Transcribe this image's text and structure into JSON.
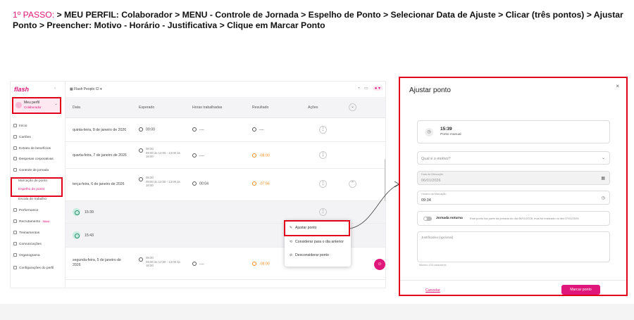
{
  "instruction": {
    "step": "1º PASSO:",
    "text": " > MEU PERFIL: Colaborador > MENU - Controle de Jornada > Espelho de Ponto > Selecionar Data de Ajuste > Clicar (três pontos) > Ajustar Ponto > Preencher: Motivo - Horário - Justificativa > Clique em Marcar Ponto"
  },
  "sidebar": {
    "logo": "flash",
    "profile": {
      "title": "Meu perfil",
      "role": "Colaborador"
    },
    "items": [
      {
        "label": "Início",
        "icon": "home-icon"
      },
      {
        "label": "Cartões",
        "icon": "card-icon"
      },
      {
        "label": "Extrato de benefícios",
        "icon": "list-icon"
      },
      {
        "label": "Despesas corporativas",
        "icon": "wallet-icon"
      },
      {
        "label": "Controle de jornada",
        "icon": "clock-icon"
      }
    ],
    "sub_items": [
      {
        "label": "Marcação de ponto"
      },
      {
        "label": "Espelho de ponto"
      },
      {
        "label": "Escala de trabalho"
      }
    ],
    "more_items": [
      {
        "label": "Performance",
        "icon": "chart-icon"
      },
      {
        "label": "Recrutamento",
        "icon": "people-icon",
        "badge": "Novo"
      },
      {
        "label": "Treinamentos",
        "icon": "book-icon"
      },
      {
        "label": "Comunicações",
        "icon": "megaphone-icon"
      },
      {
        "label": "Organograma",
        "icon": "org-icon"
      },
      {
        "label": "Configurações do perfil",
        "icon": "gear-icon"
      }
    ]
  },
  "topbar": {
    "company": "Flash Peoplo CI"
  },
  "table": {
    "headers": {
      "date": "Data",
      "expected": "Esperado",
      "worked": "Horas trabalhadas",
      "result": "Resultado",
      "actions": "Ações"
    },
    "rows": [
      {
        "date": "quinta-feira, 8 de janeiro de 2026",
        "expected": "00:00",
        "worked": "----",
        "result": "----"
      },
      {
        "date": "quarta-feira, 7 de janeiro de 2026",
        "expected_top": "08:00",
        "expected_sub": "09:00 às 12:00 - 13:00 às 18:00",
        "worked": "----",
        "result": "-08:00"
      },
      {
        "date": "terça-feira, 6 de janeiro de 2026",
        "expected_top": "08:00",
        "expected_sub": "09:00 às 12:00 - 13:00 às 18:00",
        "worked": "00:04",
        "result": "-07:56"
      },
      {
        "date": "segunda-feira, 5 de janeiro de 2026",
        "expected_top": "08:00",
        "expected_sub": "09:00 às 12:00 - 13:00 às 18:00",
        "worked": "----",
        "result": "-08:00"
      }
    ],
    "punches": [
      "15:39",
      "15:43"
    ]
  },
  "context_menu": {
    "items": [
      {
        "label": "Ajustar ponto",
        "icon": "pencil-icon"
      },
      {
        "label": "Considerar para o dia anterior",
        "icon": "arrow-back-icon"
      },
      {
        "label": "Desconsiderar ponto",
        "icon": "ban-icon"
      }
    ]
  },
  "modal": {
    "title": "Ajustar ponto",
    "punch_time": "15:39",
    "punch_type": "Ponto manual",
    "reason_placeholder": "Qual é o motivo?",
    "date_label": "Data da Marcação",
    "date_value": "06/01/2026",
    "time_label": "Horário da Marcação",
    "time_value": "09:34",
    "night_label": "Jornada noturna",
    "night_desc": "Este ponto faz parte da jornada do dia 06/01/2026, mas foi realizado no dia 07/01/2026",
    "justification_placeholder": "Justificativa (opcional)",
    "char_hint": "Mínimo 100 caracteres",
    "cancel": "Cancelar",
    "submit": "Marcar ponto"
  },
  "colors": {
    "brand": "#e0177a",
    "highlight": "#e3001b",
    "warning": "#f08c1e"
  }
}
